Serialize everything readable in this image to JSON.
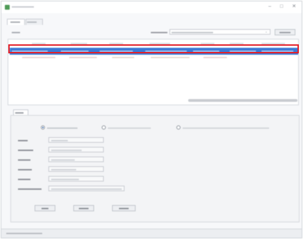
{
  "window": {
    "title": ""
  },
  "window_controls": {
    "minimize": "–",
    "maximize": "□",
    "close": "✕"
  },
  "tabs": [
    {
      "label": ""
    },
    {
      "label": ""
    }
  ],
  "toolbar": {
    "left_label": "",
    "adapter_label": "",
    "adapter_value": "",
    "refresh_label": ""
  },
  "table": {
    "columns": [
      "",
      "",
      "",
      "",
      "",
      "",
      ""
    ],
    "selected_row": [
      "",
      "",
      "",
      "",
      "",
      "",
      ""
    ],
    "row2": [
      "",
      "",
      "",
      "",
      ""
    ]
  },
  "detail": {
    "tab_label": "",
    "options": [
      "",
      "",
      ""
    ],
    "fields": [
      {
        "label": "",
        "value": ""
      },
      {
        "label": "",
        "value": ""
      },
      {
        "label": "",
        "value": ""
      },
      {
        "label": "",
        "value": ""
      },
      {
        "label": "",
        "value": ""
      },
      {
        "label": "",
        "value": ""
      }
    ],
    "buttons": [
      "",
      "",
      ""
    ]
  },
  "status": {
    "text": ""
  },
  "colors": {
    "selection": "#3a78d4",
    "highlight_outline": "#e3202a",
    "app_icon": "#4f9a57"
  },
  "icons": {
    "app": "app-icon",
    "dropdown": "chevron-down-icon"
  }
}
